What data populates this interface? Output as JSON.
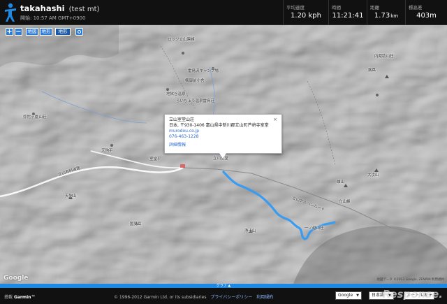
{
  "header": {
    "title": "takahashi",
    "subtitle": "(test mt)",
    "start_time": "開始: 10:57 AM GMT+0900",
    "stats": [
      {
        "label": "平均速度",
        "value": "1.20 kph",
        "unit": ""
      },
      {
        "label": "時間",
        "value": "11:21:41",
        "unit": ""
      },
      {
        "label": "距離",
        "value": "1.73",
        "unit": "km"
      },
      {
        "label": "標高差",
        "value": "403m",
        "unit": ""
      }
    ]
  },
  "toolbar": {
    "zoom_in": "+",
    "zoom_out": "−",
    "modes": [
      "地図",
      "地形",
      "地形"
    ],
    "active_mode_index": 2
  },
  "map": {
    "places": [
      "ロッジ立山連峰",
      "雷鳥沢キャンプ場",
      "剱御前小舎",
      "地獄谷温泉",
      "らいちょう温泉雷鳥荘",
      "剱岳",
      "一ノ越山荘",
      "立山荘",
      "室堂平",
      "天狗平",
      "弥陀ヶ原",
      "天狗山",
      "国見岳",
      "立山有料道路",
      "浄土山",
      "大汝山",
      "立山峰",
      "内蔵助山荘",
      "雄山",
      "立山室堂",
      "立山アルペンルート"
    ],
    "google_logo": "Google",
    "attribution": "地図データ ©2013 Google, ZENRIN  利用規約"
  },
  "infowindow": {
    "title": "立山室堂山荘",
    "address": "日本, 〒930-1406 富山県中新川郡立山町芦峅寺室堂",
    "url": "murodou.co.jp",
    "phone": "076-463-1228",
    "details_link": "詳細情報",
    "close_label": "×"
  },
  "graph_bar": {
    "label": "グラフ ▲"
  },
  "footer": {
    "powered_by": "搭載",
    "brand": "Garmin™",
    "copyright": "© 1996-2012 Garmin Ltd. or its subsidiaries",
    "links": [
      "プライバシーポリシー",
      "利用規約"
    ],
    "select_map": "Google",
    "select_language": "日本語",
    "select_units": "メートル法",
    "watermark": "Response."
  },
  "colors": {
    "accent": "#1e88e5",
    "track": "#3a9cf0",
    "header_bg": "#111111"
  }
}
